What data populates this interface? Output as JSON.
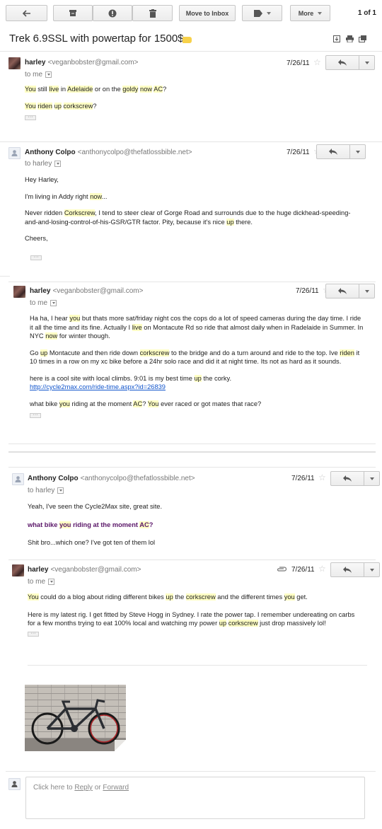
{
  "toolbar": {
    "back_icon": "back-arrow-icon",
    "archive_icon": "archive-icon",
    "spam_icon": "report-spam-icon",
    "delete_icon": "trash-icon",
    "move_to_inbox": "Move to Inbox",
    "labels_icon": "label-tag-icon",
    "more": "More",
    "pager": "1 of 1"
  },
  "subject": "Trek 6.9SSL with powertap for 1500$",
  "messages": [
    {
      "sender_name": "harley",
      "sender_email": "<veganbobster@gmail.com>",
      "recipient": "to me",
      "date": "7/26/11",
      "lines": [
        [
          "",
          "You",
          " still ",
          "live",
          " in ",
          "Adelaide",
          " or on the ",
          "goldy",
          " ",
          "now",
          " ",
          "AC",
          "?"
        ],
        [
          "",
          "You",
          " ",
          "riden",
          " ",
          "up",
          " ",
          "corkscrew",
          "?"
        ]
      ]
    },
    {
      "sender_name": "Anthony Colpo",
      "sender_email": "<anthonycolpo@thefatlossbible.net>",
      "recipient": "to harley",
      "date": "7/26/11",
      "greeting": "Hey Harley,",
      "p1": [
        "I'm living in Addy right ",
        "now",
        "..."
      ],
      "p2": [
        "Never ridden ",
        "Corkscrew",
        ", I tend to steer clear of Gorge Road and surrounds due to the huge dickhead-speeding-and-and-losing-control-of-his-GSR/GTR factor. Pity, because it's nice ",
        "up",
        " there."
      ],
      "signoff": "Cheers,"
    },
    {
      "sender_name": "harley",
      "sender_email": "<veganbobster@gmail.com>",
      "recipient": "to me",
      "date": "7/26/11",
      "p1": [
        "Ha ha, I hear ",
        "you",
        " but thats more sat/friday night cos the cops do a lot of speed cameras during the day time. I ride it all the time and its fine. Actually I ",
        "live",
        " on Montacute Rd so ride that almost daily when in Radelaide in Summer. In NYC ",
        "now",
        " for winter though."
      ],
      "p2": [
        "Go ",
        "up",
        " Montacute and then ride down ",
        "corkscrew",
        " to the bridge and do a turn around and ride to the top. Ive ",
        "riden",
        " it 10 times in a row on my xc bike before a 24hr solo race and did it at night time. Its not as hard as it sounds."
      ],
      "p3": [
        "here is a cool site with local climbs. 9:01 is my best time ",
        "up",
        " the corky."
      ],
      "link": "http://cycle2max.com/ride-time.aspx?id=26839",
      "p4": [
        "what bike ",
        "you",
        " riding at the moment ",
        "AC",
        "? ",
        "You",
        " ever raced or got mates that race?"
      ]
    },
    {
      "sender_name": "Anthony Colpo",
      "sender_email": "<anthonycolpo@thefatlossbible.net>",
      "recipient": "to harley",
      "date": "7/26/11",
      "p1": "Yeah, I've seen the Cycle2Max site, great site.",
      "quote": [
        "what bike ",
        "you",
        " riding at the moment ",
        "AC",
        "?"
      ],
      "p2": "Shit bro...which one? I've got ten of them lol"
    },
    {
      "sender_name": "harley",
      "sender_email": "<veganbobster@gmail.com>",
      "recipient": "to me",
      "date": "7/26/11",
      "attachment_icon": "paperclip-icon",
      "p1": [
        "",
        "You",
        " could do a blog about riding different bikes ",
        "up",
        " the ",
        "corkscrew",
        " and the different times ",
        "you",
        " get."
      ],
      "p2": [
        "Here is my latest rig. I get fitted by Steve Hogg in Sydney. I rate the power tap. I remember undereating on carbs for a few months trying to eat 100% local and watching my power ",
        "up",
        " ",
        "corkscrew",
        " just drop massively lol!"
      ]
    }
  ],
  "reply_box": {
    "prefix": "Click here to ",
    "reply": "Reply",
    "or": " or ",
    "forward": "Forward"
  },
  "colors": {
    "highlight": "#ffffc4",
    "label": "#f7d14a",
    "link": "#1155cc",
    "quote": "#5a1668"
  }
}
